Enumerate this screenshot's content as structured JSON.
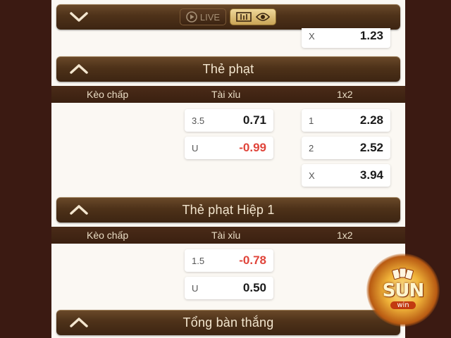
{
  "toolbar": {
    "live_label": "LIVE"
  },
  "top_partial": {
    "label": "X",
    "value": "1.23"
  },
  "sections": [
    {
      "title": "Thẻ phạt",
      "columns": [
        "Kèo chấp",
        "Tài xỉu",
        "1x2"
      ],
      "tai_xiu": [
        {
          "label": "3.5",
          "value": "0.71",
          "negative": false
        },
        {
          "label": "U",
          "value": "-0.99",
          "negative": true
        }
      ],
      "one_x_two": [
        {
          "label": "1",
          "value": "2.28"
        },
        {
          "label": "2",
          "value": "2.52"
        },
        {
          "label": "X",
          "value": "3.94"
        }
      ]
    },
    {
      "title": "Thẻ phạt Hiệp 1",
      "columns": [
        "Kèo chấp",
        "Tài xỉu",
        "1x2"
      ],
      "tai_xiu": [
        {
          "label": "1.5",
          "value": "-0.78",
          "negative": true
        },
        {
          "label": "U",
          "value": "0.50",
          "negative": false
        }
      ]
    },
    {
      "title": "Tổng bàn thắng"
    }
  ],
  "logo": {
    "text": "SUN",
    "subtext": "win"
  },
  "colors": {
    "background": "#3a1a12",
    "panel": "#fbf8f3",
    "header_bar": "#4e3219",
    "negative": "#e0443a",
    "accent_gold": "#c9a456"
  },
  "icons": [
    "chevron-down-icon",
    "play-icon",
    "stats-icon",
    "eye-icon",
    "chevron-up-icon"
  ]
}
